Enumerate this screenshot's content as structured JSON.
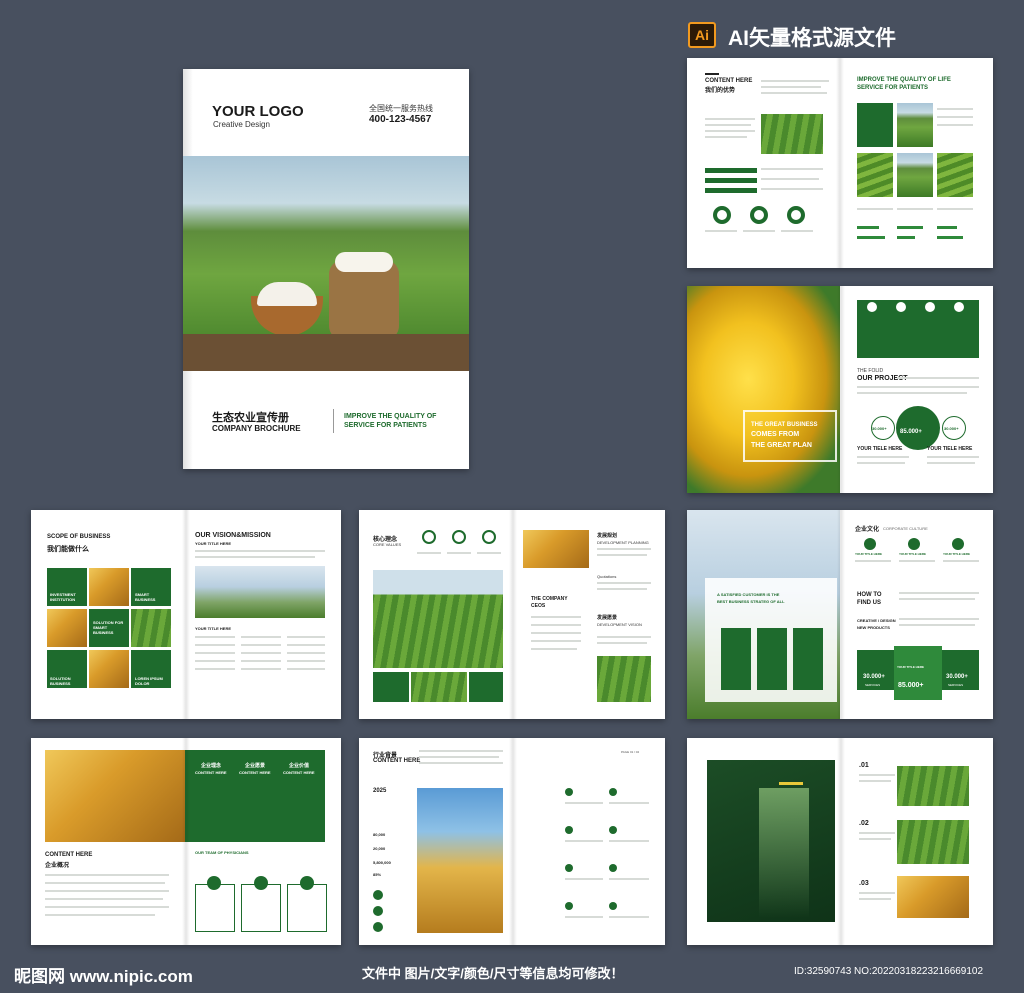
{
  "header": {
    "ai_badge": "Ai",
    "title": "AI矢量格式源文件"
  },
  "cover": {
    "logo": "YOUR LOGO",
    "logo_sub": "Creative Design",
    "hotline_label": "全国统一服务热线",
    "hotline": "400-123-4567",
    "title_cn": "生态农业宣传册",
    "title_en": "COMPANY BROCHURE",
    "tagline_1": "IMPROVE THE QUALITY OF",
    "tagline_2": "SERVICE FOR PATIENTS"
  },
  "spread1": {
    "heading_en": "CONTENT HERE",
    "heading_cn": "我们的优势",
    "right_title_1": "IMPROVE THE QUALITY OF LIFE",
    "right_title_2": "SERVICE FOR PATIENTS"
  },
  "spread2": {
    "banner_1": "THE GREAT BUSINESS",
    "banner_2": "COMES FROM",
    "banner_3": "THE GREAT PLAN",
    "label": "THE FOLID",
    "title": "OUR PROJECT",
    "stat": "85.000+",
    "stat_left": "30.000+",
    "stat_right": "30.000+",
    "sub_left": "YOUR TIELE HERE",
    "sub_right": "YOUR TIELE HERE"
  },
  "spread3": {
    "label": "SCOPE OF BUSINESS",
    "title_cn": "我们能做什么",
    "tiles": [
      "INVESTMENT INSTITUTION",
      "SMART BUSINESS",
      "SOLUTION FOR SMART BUSINESS",
      "SOLUTION BUSINESS",
      "LOREN IPSUM DOLOR"
    ],
    "right_title": "OUR VISION&MISSION",
    "right_sub": "YOUR TITLE HERE"
  },
  "spread4": {
    "title_cn": "核心理念",
    "title_en": "CORE VALUES",
    "right_title_cn": "发展规划",
    "right_title_en": "DEVELOPMENT PLANNING",
    "ceo_1": "THE COMPANY",
    "ceo_2": "CEOS",
    "vision_cn": "发展愿景",
    "vision_en": "DEVELOPMENT VISION",
    "quote": "Quotations"
  },
  "spread5": {
    "title_cn": "企业文化",
    "title_en": "CORPORATE CULTURE",
    "banner_1": "A SATISFIED CUSTOMER IS THE",
    "banner_2": "BEST BUSINESS STRATEG OF ALL",
    "how_1": "HOW TO",
    "how_2": "FIND US",
    "creative_1": "CREATIVE / DESIGN",
    "creative_2": "NEW PRODUCTS",
    "col_title": "YOUR TITLE HERE",
    "stat_left": "30.000+",
    "stat_center": "85.000+",
    "stat_right": "30.000+",
    "services": "SERVICES"
  },
  "spread6": {
    "col_titles": [
      "企业理念",
      "企业愿景",
      "企业价值"
    ],
    "col_sub": "CONTENT HERE",
    "heading_en": "CONTENT HERE",
    "heading_cn": "企业概况",
    "team": "OUR TEAM OF PHYSICIANS"
  },
  "spread7": {
    "title_cn": "行业背景",
    "title_en": "CONTENT HERE",
    "year": "2025",
    "nums": [
      "80,000",
      "20,000",
      "5,800,000",
      "85%"
    ],
    "page_label": "PAGE 01 / 02"
  },
  "spread8": {
    "steps": [
      ".01",
      ".02",
      ".03"
    ]
  },
  "footer": {
    "brand": "昵图网 www.nipic.com",
    "notice": "文件中 图片/文字/颜色/尺寸等信息均可修改！",
    "id": "ID:32590743 NO:20220318223216669102"
  },
  "colors": {
    "background": "#48505f",
    "brand_green": "#1e6b2d",
    "accent_green": "#2f8a3b",
    "ai_orange": "#f29a1f"
  }
}
